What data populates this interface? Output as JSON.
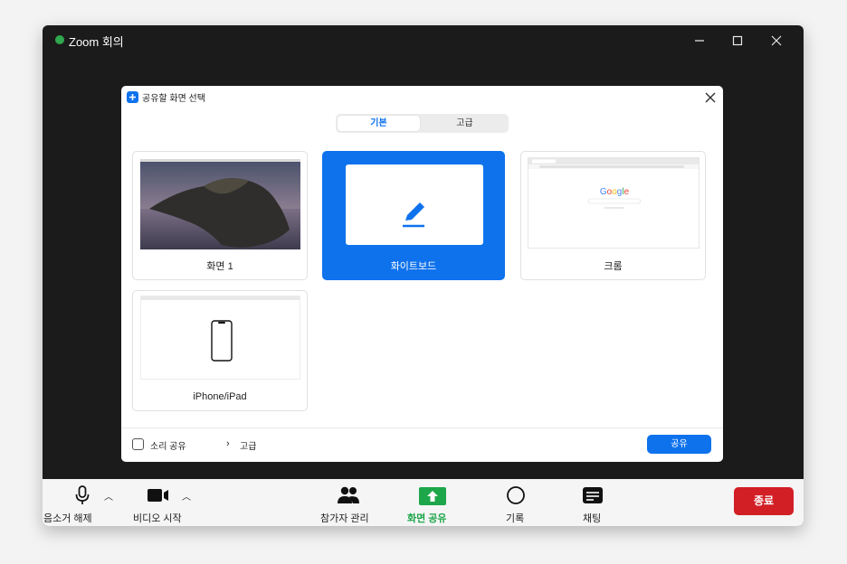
{
  "window": {
    "title": "Zoom 회의"
  },
  "dialog": {
    "title": "공유할 화면 선택",
    "tabs": [
      {
        "label": "기본"
      },
      {
        "label": "고급"
      }
    ],
    "cards": [
      {
        "label": "화면 1"
      },
      {
        "label": "화이트보드"
      },
      {
        "label": "크롬"
      },
      {
        "label": "iPhone/iPad"
      }
    ],
    "footer": {
      "sound_share": "소리 공유",
      "advanced": "고급",
      "share_button": "공유"
    }
  },
  "toolbar": {
    "mute": "음소거 해제",
    "video": "비디오 시작",
    "participants": "참가자 관리",
    "share": "화면 공유",
    "record": "기록",
    "chat": "채팅",
    "end": "종료"
  },
  "colors": {
    "accent": "#0e72ed",
    "end": "#d21f26",
    "share_green": "#1ea64a"
  }
}
